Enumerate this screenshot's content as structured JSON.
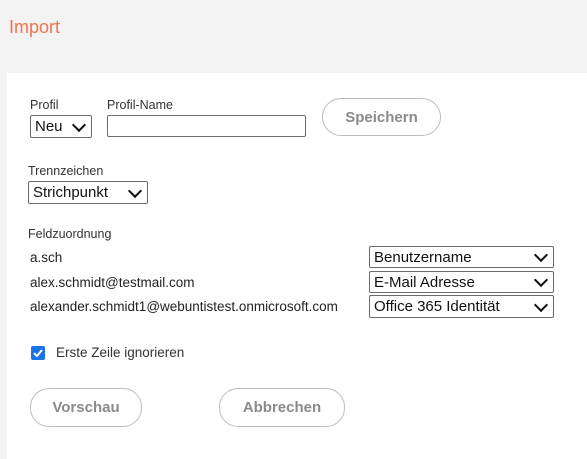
{
  "page": {
    "title": "Import"
  },
  "profile": {
    "profil_label": "Profil",
    "profil_value": "Neu",
    "name_label": "Profil-Name",
    "name_value": "",
    "save_label": "Speichern"
  },
  "separator": {
    "label": "Trennzeichen",
    "value": "Strichpunkt"
  },
  "mapping": {
    "label": "Feldzuordnung",
    "rows": [
      {
        "sample": "a.sch",
        "field": "Benutzername"
      },
      {
        "sample": "alex.schmidt@testmail.com",
        "field": "E-Mail Adresse"
      },
      {
        "sample": "alexander.schmidt1@webuntistest.onmicrosoft.com",
        "field": "Office 365 Identität"
      }
    ]
  },
  "options": {
    "skip_first_row_label": "Erste Zeile ignorieren",
    "skip_first_row_checked": true
  },
  "actions": {
    "preview_label": "Vorschau",
    "cancel_label": "Abbrechen"
  },
  "colors": {
    "title": "#f0734f",
    "checkbox": "#1a73e8",
    "background": "#f3f3f3"
  }
}
